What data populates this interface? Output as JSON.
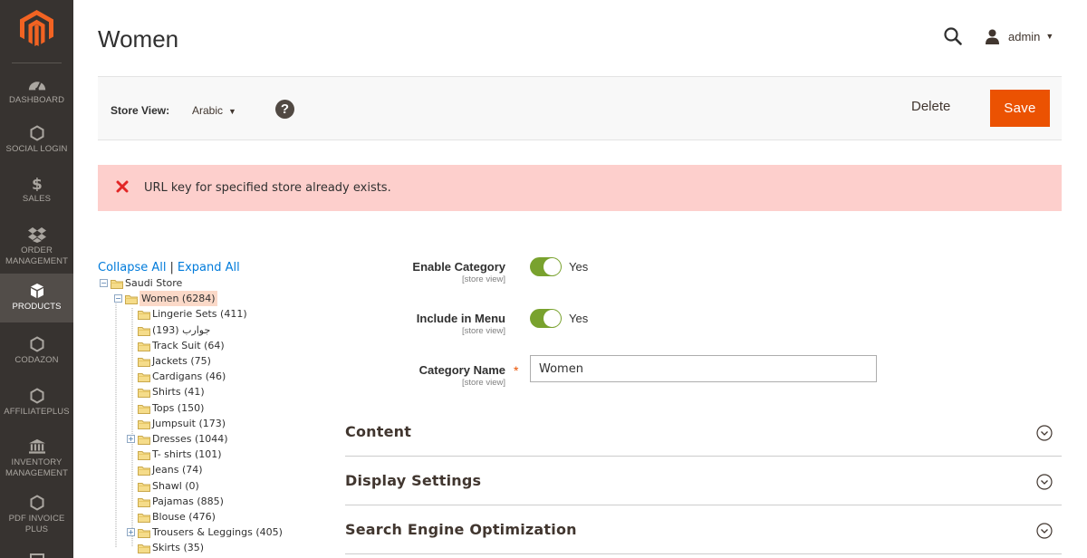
{
  "sidebar": {
    "items": [
      {
        "label": "DASHBOARD",
        "icon": "dashboard-icon"
      },
      {
        "label": "SOCIAL LOGIN",
        "icon": "hexagon-icon"
      },
      {
        "label": "SALES",
        "icon": "dollar-icon"
      },
      {
        "label": "ORDER MANAGEMENT",
        "icon": "dropbox-icon"
      },
      {
        "label": "PRODUCTS",
        "icon": "box-icon",
        "active": true
      },
      {
        "label": "CODAZON",
        "icon": "hexagon-icon"
      },
      {
        "label": "AFFILIATEPLUS",
        "icon": "hexagon-icon"
      },
      {
        "label": "INVENTORY MANAGEMENT",
        "icon": "bank-icon"
      },
      {
        "label": "PDF INVOICE PLUS",
        "icon": "hexagon-icon"
      }
    ]
  },
  "header": {
    "title": "Women",
    "user": "admin"
  },
  "store_bar": {
    "label": "Store View:",
    "value": "Arabic",
    "help": "?",
    "delete_label": "Delete",
    "save_label": "Save"
  },
  "message": {
    "text": "URL key for specified store already exists."
  },
  "tree": {
    "collapse_all": "Collapse All",
    "separator": "|",
    "expand_all": "Expand All",
    "nodes": [
      {
        "label": "Saudi Store",
        "level": 0,
        "toggle": "-"
      },
      {
        "label": "Women (6284)",
        "level": 1,
        "toggle": "-",
        "selected": true
      },
      {
        "label": "Lingerie Sets (411)",
        "level": 2
      },
      {
        "label": "جوارب (193)",
        "level": 2
      },
      {
        "label": "Track Suit (64)",
        "level": 2
      },
      {
        "label": "Jackets (75)",
        "level": 2
      },
      {
        "label": "Cardigans (46)",
        "level": 2
      },
      {
        "label": "Shirts (41)",
        "level": 2
      },
      {
        "label": "Tops (150)",
        "level": 2
      },
      {
        "label": "Jumpsuit (173)",
        "level": 2
      },
      {
        "label": "Dresses (1044)",
        "level": 2,
        "toggle": "+"
      },
      {
        "label": "T- shirts (101)",
        "level": 2
      },
      {
        "label": "Jeans (74)",
        "level": 2
      },
      {
        "label": "Shawl (0)",
        "level": 2
      },
      {
        "label": "Pajamas (885)",
        "level": 2
      },
      {
        "label": "Blouse (476)",
        "level": 2
      },
      {
        "label": "Trousers & Leggings (405)",
        "level": 2,
        "toggle": "+"
      },
      {
        "label": "Skirts (35)",
        "level": 2
      }
    ]
  },
  "form": {
    "enable_category": {
      "label": "Enable Category",
      "scope": "[store view]",
      "value": "Yes"
    },
    "include_in_menu": {
      "label": "Include in Menu",
      "scope": "[store view]",
      "value": "Yes"
    },
    "category_name": {
      "label": "Category Name",
      "scope": "[store view]",
      "required": "*",
      "value": "Women"
    }
  },
  "sections": [
    {
      "title": "Content"
    },
    {
      "title": "Display Settings"
    },
    {
      "title": "Search Engine Optimization"
    }
  ],
  "colors": {
    "sidebar_bg": "#373330",
    "accent_orange": "#eb5202",
    "toggle_on": "#79a22e",
    "error_bg": "#fdcfcc",
    "link_blue": "#007bdb"
  }
}
